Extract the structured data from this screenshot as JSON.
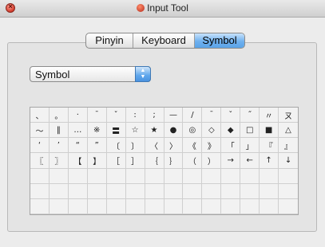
{
  "window": {
    "title": "Input Tool"
  },
  "tabs": [
    {
      "label": "Pinyin",
      "selected": false
    },
    {
      "label": "Keyboard",
      "selected": false
    },
    {
      "label": "Symbol",
      "selected": true
    }
  ],
  "category_select": {
    "value": "Symbol"
  },
  "symbols": [
    [
      "、",
      "。",
      "·",
      "ˉ",
      "ˇ",
      "¨",
      "〃",
      "々",
      "—",
      "～",
      "‖",
      "…",
      "‘",
      "’"
    ],
    [
      "“",
      "”",
      "〔",
      "〕",
      "〈",
      "〉",
      "《",
      "》",
      "「",
      "」",
      "『",
      "』",
      "〖",
      "〗"
    ],
    [
      "【",
      "】",
      "±",
      "×",
      "÷",
      "∶",
      "∧",
      "∨",
      "∑",
      "∏",
      "∪",
      "∩",
      "∈",
      "∷"
    ],
    [
      "√",
      "⊥",
      "∥",
      "∠",
      "⌒",
      "⊙",
      "∫",
      "∮",
      "≡",
      "≌",
      "≈",
      "∽",
      "∝",
      "≠"
    ],
    [
      "",
      "",
      "",
      "",
      "",
      "",
      "",
      "",
      "",
      "",
      "",
      "",
      "",
      ""
    ],
    [
      "",
      "",
      "",
      "",
      "",
      "",
      "",
      "",
      "",
      "",
      "",
      "",
      "",
      ""
    ],
    [
      "",
      "",
      "",
      "",
      "",
      "",
      "",
      "",
      "",
      "",
      "",
      "",
      "",
      ""
    ]
  ],
  "symbols_visible": [
    [
      "、",
      "。",
      "·",
      "ˉ",
      "ˇ",
      "¨",
      "〃",
      "々",
      "—",
      "／",
      "‾",
      "ˇ",
      "˝",
      "〃",
      "ㄡ",
      "—"
    ],
    [],
    []
  ],
  "grid": {
    "rows": [
      [
        "、",
        "。",
        "·",
        "ˉ",
        "ˇ",
        ":",
        ";",
        "—",
        "/",
        "¯",
        "ˇ",
        "˝",
        "〃",
        "ㄡ"
      ],
      [
        "～",
        "‖",
        "…",
        "※",
        "〓",
        "☆",
        "★",
        "●",
        "◎",
        "◇",
        "◆",
        "□",
        "■",
        "△"
      ],
      [
        "‘",
        "’",
        "“",
        "”",
        "〔",
        "〕",
        "〈",
        "〉",
        "《",
        "》",
        "「",
        "」",
        "『",
        "』"
      ],
      [
        "〖",
        "〗",
        "【",
        "】",
        "［",
        "］",
        "｛",
        "｝",
        "（",
        "）",
        "→",
        "←",
        "↑",
        "↓"
      ],
      [
        "",
        "",
        "",
        "",
        "",
        "",
        "",
        "",
        "",
        "",
        "",
        "",
        "",
        ""
      ],
      [
        "",
        "",
        "",
        "",
        "",
        "",
        "",
        "",
        "",
        "",
        "",
        "",
        "",
        ""
      ],
      [
        "",
        "",
        "",
        "",
        "",
        "",
        "",
        "",
        "",
        "",
        "",
        "",
        "",
        ""
      ]
    ],
    "extra_column_symbols": [
      "—",
      "▲",
      "",
      ""
    ]
  }
}
